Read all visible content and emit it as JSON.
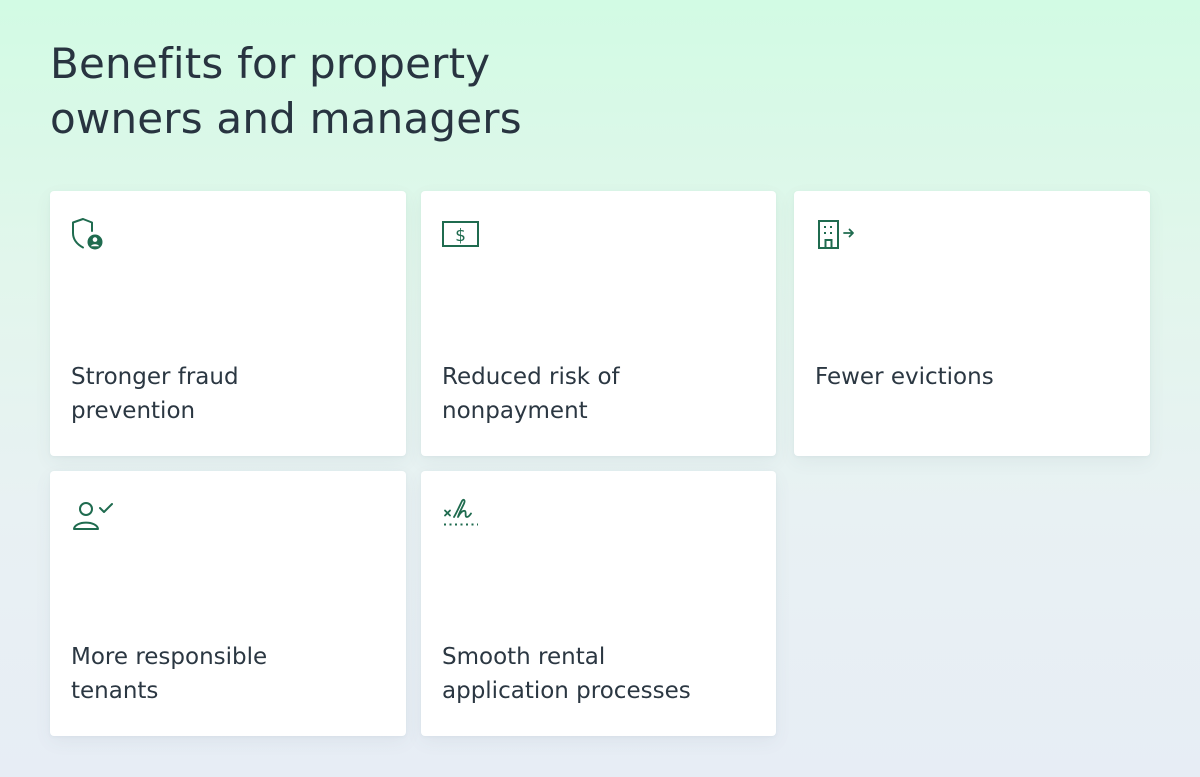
{
  "heading": {
    "line1": "Benefits for property",
    "line2": "owners and managers"
  },
  "colors": {
    "accent": "#1f6b4f",
    "card_background": "#ffffff",
    "text": "#2b3742"
  },
  "cards": [
    {
      "icon": "shield-user-icon",
      "line1": "Stronger fraud",
      "line2": "prevention"
    },
    {
      "icon": "dollar-bill-icon",
      "line1": "Reduced risk of",
      "line2": "nonpayment"
    },
    {
      "icon": "building-exit-icon",
      "line1": "Fewer evictions",
      "line2": ""
    },
    {
      "icon": "user-check-icon",
      "line1": "More responsible",
      "line2": "tenants"
    },
    {
      "icon": "signature-icon",
      "line1": "Smooth rental",
      "line2": "application processes"
    }
  ]
}
